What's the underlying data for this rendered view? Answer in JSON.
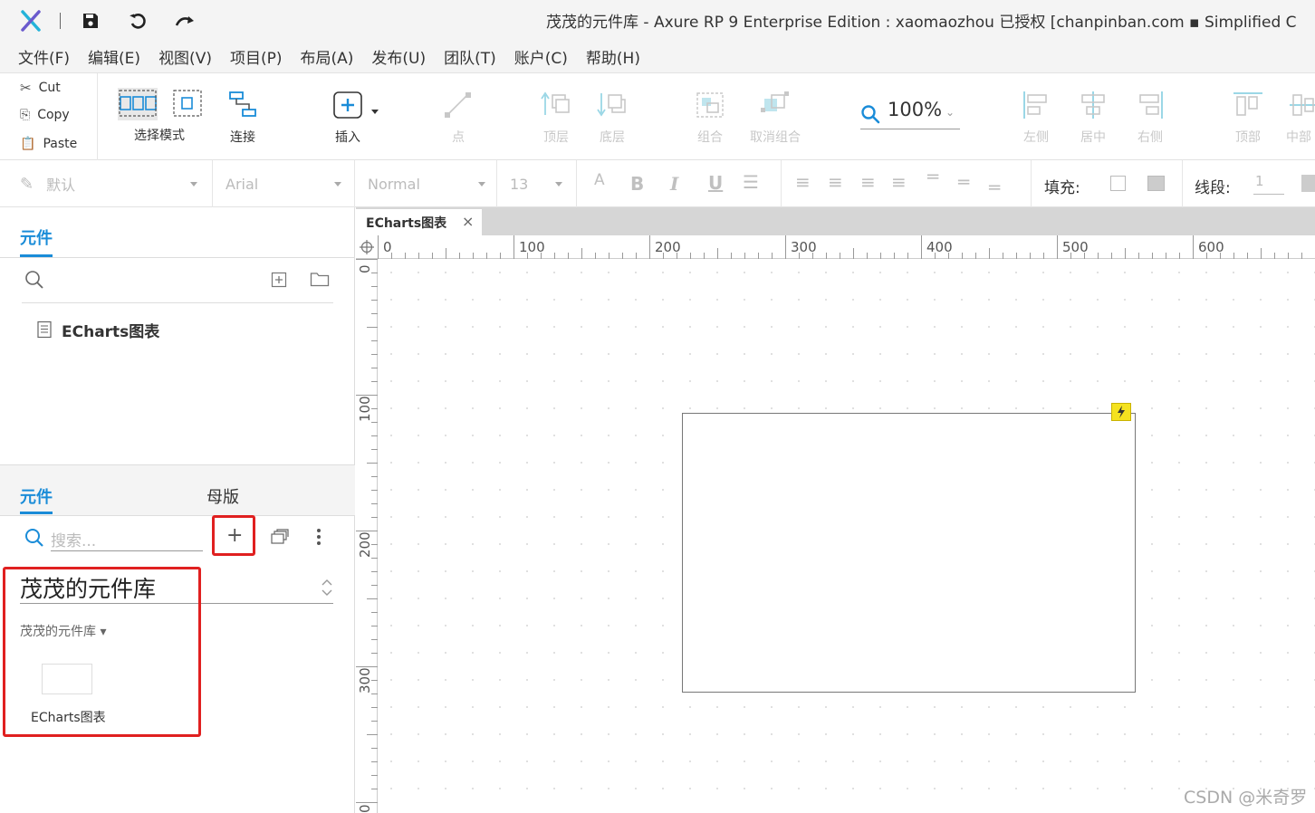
{
  "app": {
    "window_title": "茂茂的元件库 - Axure RP 9 Enterprise Edition : xaomaozhou 已授权    [chanpinban.com ▪ Simplified C"
  },
  "menu": [
    "文件(F)",
    "编辑(E)",
    "视图(V)",
    "项目(P)",
    "布局(A)",
    "发布(U)",
    "团队(T)",
    "账户(C)",
    "帮助(H)"
  ],
  "clipboard": {
    "cut": "Cut",
    "copy": "Copy",
    "paste": "Paste"
  },
  "toolbar": {
    "select_mode": "选择模式",
    "connect": "连接",
    "insert": "插入",
    "point": "点",
    "top_layer": "顶层",
    "bottom_layer": "底层",
    "group": "组合",
    "ungroup": "取消组合",
    "zoom": "100%",
    "align_left": "左侧",
    "align_center": "居中",
    "align_right": "右侧",
    "align_top": "顶部",
    "align_middle": "中部"
  },
  "stylebar": {
    "style": "默认",
    "font": "Arial",
    "weight": "Normal",
    "size": "13",
    "fill_label": "填充:",
    "stroke_label": "线段:",
    "stroke_value": "1"
  },
  "pages_pane": {
    "tab": "元件",
    "page_item": "ECharts图表"
  },
  "library_pane": {
    "tab_widgets": "元件",
    "tab_masters": "母版",
    "search_placeholder": "搜索...",
    "library_name": "茂茂的元件库",
    "section_name": "茂茂的元件库 ▾",
    "widget_label": "ECharts图表"
  },
  "canvas": {
    "doc_tab": "ECharts图表",
    "ruler_h": [
      "0",
      "100",
      "200",
      "300",
      "400",
      "500",
      "600"
    ],
    "ruler_v": [
      "0",
      "100",
      "200",
      "300",
      "0"
    ]
  },
  "watermark": "CSDN @米奇罗",
  "colors": {
    "accent": "#1a8cd8",
    "highlight": "#e02020",
    "interaction_badge": "#f5e21f"
  }
}
